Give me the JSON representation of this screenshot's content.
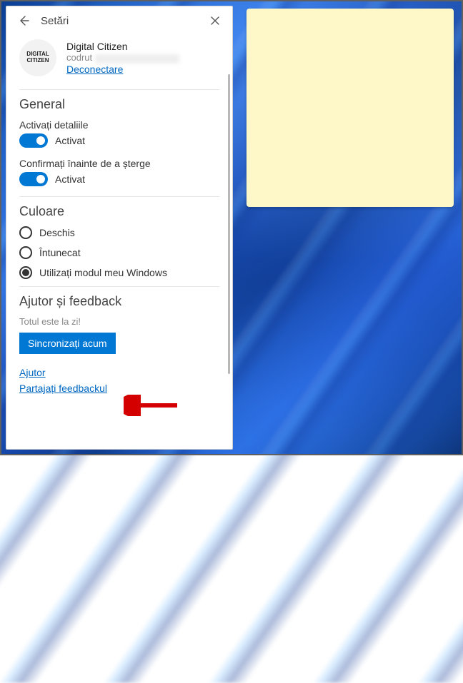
{
  "header": {
    "title": "Setări"
  },
  "account": {
    "avatar_text": "DIGITAL CITIZEN",
    "name": "Digital Citizen",
    "email_prefix": "codrut",
    "signout": "Deconectare"
  },
  "general": {
    "title": "General",
    "detail_label": "Activați detaliile",
    "detail_state": "Activat",
    "confirm_label": "Confirmați înainte de a șterge",
    "confirm_state": "Activat"
  },
  "color": {
    "title": "Culoare",
    "options": [
      {
        "label": "Deschis",
        "selected": false
      },
      {
        "label": "Întunecat",
        "selected": false
      },
      {
        "label": "Utilizați modul meu Windows",
        "selected": true
      }
    ]
  },
  "help": {
    "title": "Ajutor și feedback",
    "status": "Totul este la zi!",
    "sync_button": "Sincronizați acum",
    "help_link": "Ajutor",
    "feedback_link": "Partajați feedbackul"
  }
}
